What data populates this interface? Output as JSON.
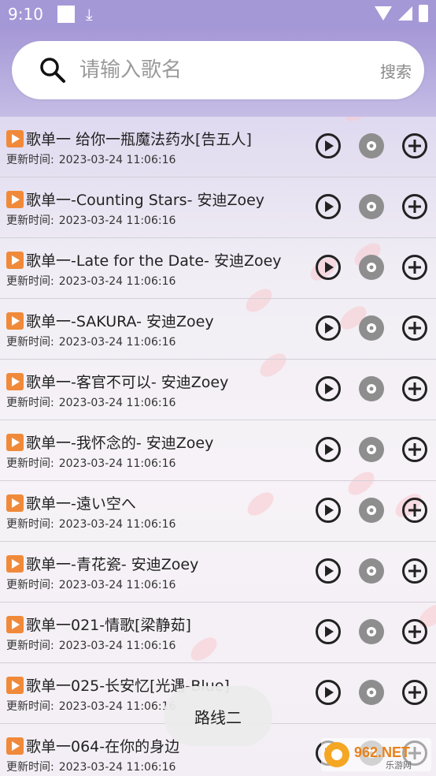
{
  "status_bar": {
    "time": "9:10",
    "icons": [
      "square-icon",
      "download-icon",
      "wifi-icon",
      "signal-icon",
      "battery-icon"
    ]
  },
  "search": {
    "placeholder": "请输入歌名",
    "button_label": "搜索",
    "value": ""
  },
  "list": {
    "time_label": "更新时间:",
    "items": [
      {
        "title": "歌单一 给你一瓶魔法药水[告五人]",
        "time": "2023-03-24 11:06:16"
      },
      {
        "title": "歌单一-Counting Stars- 安迪Zoey",
        "time": "2023-03-24 11:06:16"
      },
      {
        "title": "歌单一-Late for the Date- 安迪Zoey",
        "time": "2023-03-24 11:06:16"
      },
      {
        "title": "歌单一-SAKURA- 安迪Zoey",
        "time": "2023-03-24 11:06:16"
      },
      {
        "title": "歌单一-客官不可以- 安迪Zoey",
        "time": "2023-03-24 11:06:16"
      },
      {
        "title": "歌单一-我怀念的- 安迪Zoey",
        "time": "2023-03-24 11:06:16"
      },
      {
        "title": "歌单一-遠い空へ",
        "time": "2023-03-24 11:06:16"
      },
      {
        "title": "歌单一-青花瓷- 安迪Zoey",
        "time": "2023-03-24 11:06:16"
      },
      {
        "title": "歌单一021-情歌[梁静茹]",
        "time": "2023-03-24 11:06:16"
      },
      {
        "title": "歌单一025-长安忆[光遇-Blue]",
        "time": "2023-03-24 11:06:16"
      },
      {
        "title": "歌单一064-在你的身边",
        "time": "2023-03-24 11:06:16"
      }
    ]
  },
  "toast": {
    "text": "路线二"
  },
  "watermark": {
    "text": "962.NET",
    "sub": "乐游网"
  },
  "colors": {
    "header": "#a598d6",
    "play_tag": "#f08a3a",
    "icon_dark": "#222222",
    "disc_gray": "#8e8e8e"
  }
}
